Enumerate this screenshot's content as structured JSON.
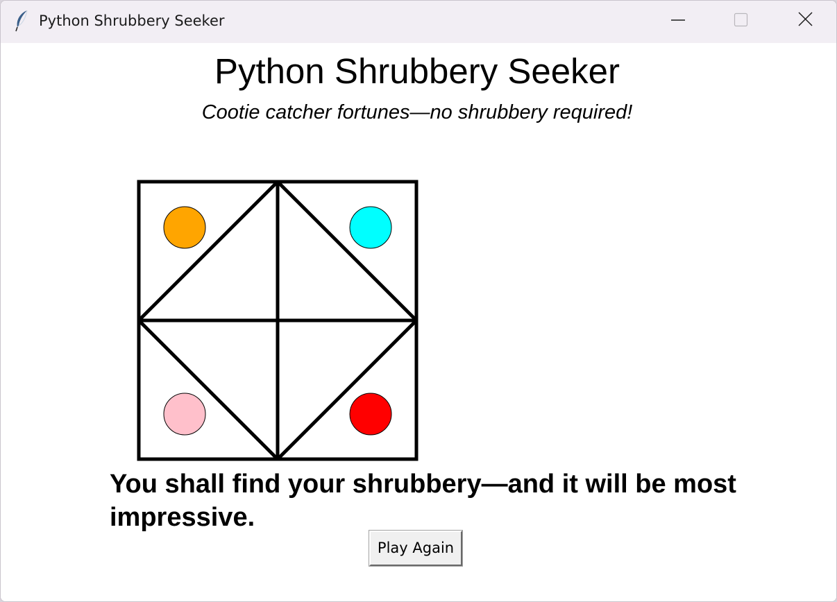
{
  "window": {
    "title": "Python Shrubbery Seeker",
    "app_icon": "feather-icon",
    "controls": {
      "minimize": "minimize-icon",
      "maximize": "maximize-icon",
      "close": "close-icon"
    }
  },
  "main": {
    "title": "Python Shrubbery Seeker",
    "subtitle": "Cootie catcher fortunes—no shrubbery required!",
    "fortune": "You shall find your shrubbery—and it will be most impressive.",
    "play_again_label": "Play Again"
  },
  "cootie_catcher": {
    "colors": {
      "top_left": "#ffa500",
      "top_right": "#00ffff",
      "bottom_left": "#ffc0cb",
      "bottom_right": "#ff0000"
    },
    "line_color": "#000000"
  }
}
